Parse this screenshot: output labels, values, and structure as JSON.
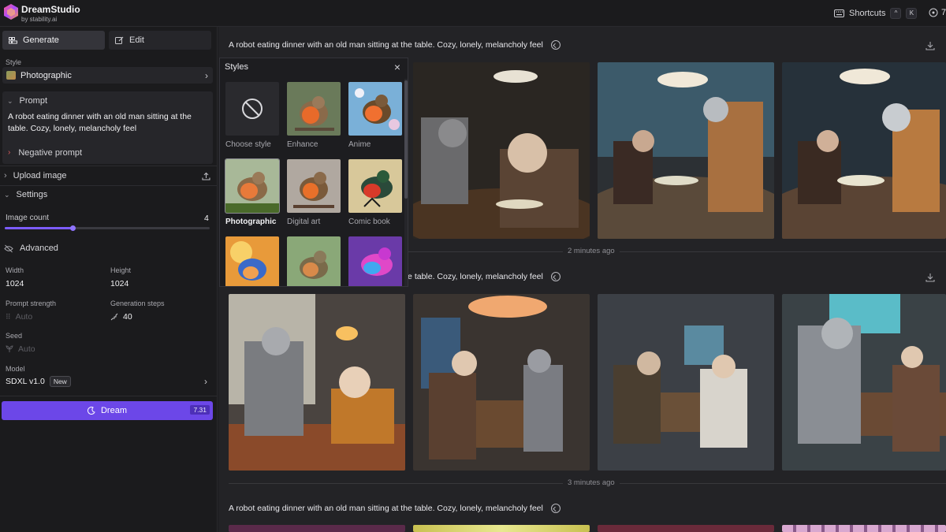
{
  "app": {
    "name": "DreamStudio",
    "byline": "by stability.ai"
  },
  "topbar": {
    "shortcuts_label": "Shortcuts",
    "shortcut_keys": [
      "^",
      "K"
    ],
    "credits": "7,"
  },
  "tabs": [
    {
      "label": "Generate",
      "active": true
    },
    {
      "label": "Edit",
      "active": false
    }
  ],
  "style": {
    "label": "Style",
    "value": "Photographic"
  },
  "prompt": {
    "label": "Prompt",
    "text": "A robot eating dinner with an old man sitting at the table. Cozy, lonely, melancholy feel"
  },
  "negative_prompt": {
    "label": "Negative prompt"
  },
  "upload_image": {
    "label": "Upload image"
  },
  "settings": {
    "label": "Settings",
    "image_count": {
      "label": "Image count",
      "value": "4",
      "level": 0.33
    },
    "advanced": {
      "label": "Advanced"
    },
    "width": {
      "label": "Width",
      "value": "1024"
    },
    "height": {
      "label": "Height",
      "value": "1024"
    },
    "prompt_strength": {
      "label": "Prompt strength",
      "value": "Auto"
    },
    "generation_steps": {
      "label": "Generation steps",
      "value": "40"
    },
    "seed": {
      "label": "Seed",
      "value": "Auto"
    },
    "model": {
      "label": "Model",
      "value": "SDXL v1.0",
      "badge": "New"
    }
  },
  "dream": {
    "label": "Dream",
    "cost": "7.31"
  },
  "styles_popover": {
    "title": "Styles",
    "items": [
      {
        "label": "Choose style"
      },
      {
        "label": "Enhance"
      },
      {
        "label": "Anime"
      },
      {
        "label": "Photographic",
        "selected": true
      },
      {
        "label": "Digital art"
      },
      {
        "label": "Comic book"
      },
      {
        "label": ""
      },
      {
        "label": ""
      },
      {
        "label": ""
      }
    ]
  },
  "gallery": [
    {
      "prompt": "A robot eating dinner with an old man sitting at the table. Cozy, lonely, melancholy feel",
      "time": "2 minutes ago"
    },
    {
      "prompt": "A robot eating dinner with an old man sitting at the table. Cozy, lonely, melancholy feel",
      "time": "3 minutes ago"
    },
    {
      "prompt": "A robot eating dinner with an old man sitting at the table. Cozy, lonely, melancholy feel",
      "time": ""
    }
  ],
  "colors": {
    "accent": "#6c47e8",
    "background": "#1b1b1d",
    "panel": "#26262a"
  }
}
